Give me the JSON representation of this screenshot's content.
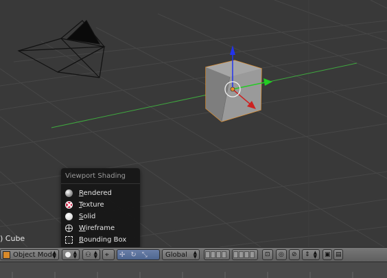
{
  "viewport": {
    "object_label": ") Cube"
  },
  "shading_menu": {
    "title": "Viewport Shading",
    "items": [
      {
        "key": "R",
        "rest": "endered",
        "icon": "rendered-sphere-icon"
      },
      {
        "key": "T",
        "rest": "exture",
        "icon": "texture-sphere-icon"
      },
      {
        "key": "S",
        "rest": "olid",
        "icon": "solid-sphere-icon"
      },
      {
        "key": "W",
        "rest": "ireframe",
        "icon": "wireframe-sphere-icon"
      },
      {
        "key": "B",
        "rest": "ounding Box",
        "icon": "bounding-box-icon"
      }
    ]
  },
  "header": {
    "mode_label": "Object Mode",
    "orientation_label": "Global"
  },
  "colors": {
    "x_axis": "#cc2222",
    "y_axis": "#22cc22",
    "z_axis": "#2233ee",
    "selection": "#e8922a",
    "grid": "#4a4a4a",
    "background": "#393939"
  }
}
